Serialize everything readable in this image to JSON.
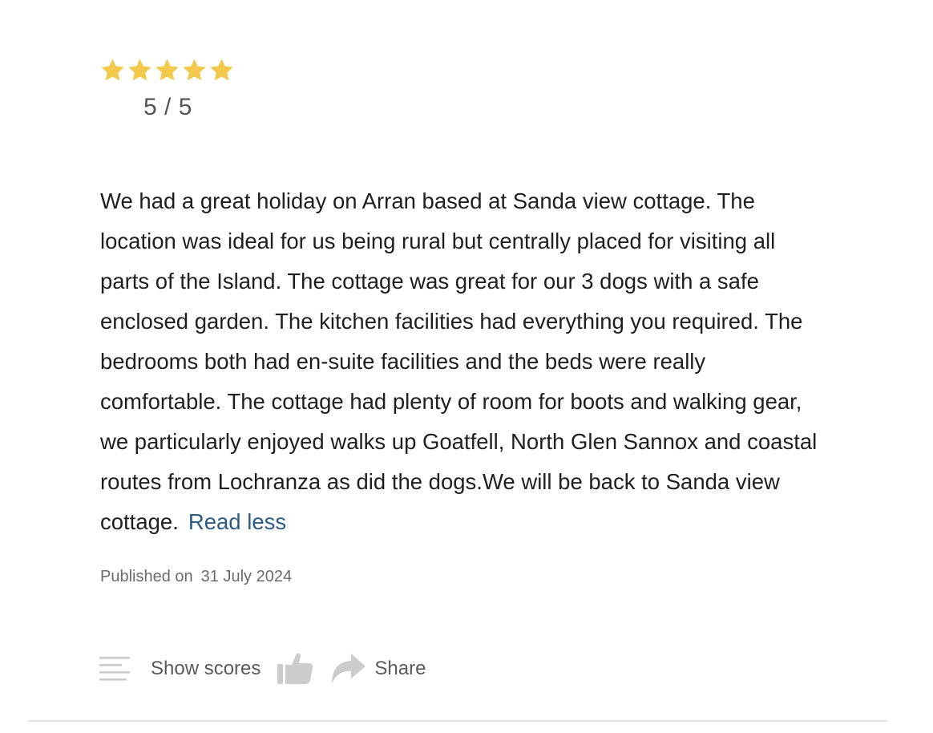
{
  "rating": {
    "stars_filled": 5,
    "stars_total": 5,
    "score_text": "5 / 5",
    "star_color": "#f2c94c"
  },
  "review": {
    "text": "We had a great holiday on Arran based at Sanda view cottage. The location was ideal for us being rural but centrally placed for visiting all parts of the Island. The cottage was great for our 3 dogs with a safe enclosed garden. The kitchen facilities had everything you required. The bedrooms both had en-suite facilities and the beds were really comfortable. The cottage had plenty of room for boots and walking gear, we particularly enjoyed walks up Goatfell, North Glen Sannox and coastal routes from Lochranza as did the dogs.We will be back to Sanda view cottage.",
    "read_less_label": "Read less"
  },
  "published": {
    "label": "Published on",
    "date": "31 July 2024"
  },
  "actions": {
    "show_scores_icon": "lines-icon",
    "show_scores_label": "Show scores",
    "like_icon": "thumbs-up-icon",
    "share_icon": "share-arrow-icon",
    "share_label": "Share",
    "icon_color": "#cccccc"
  }
}
